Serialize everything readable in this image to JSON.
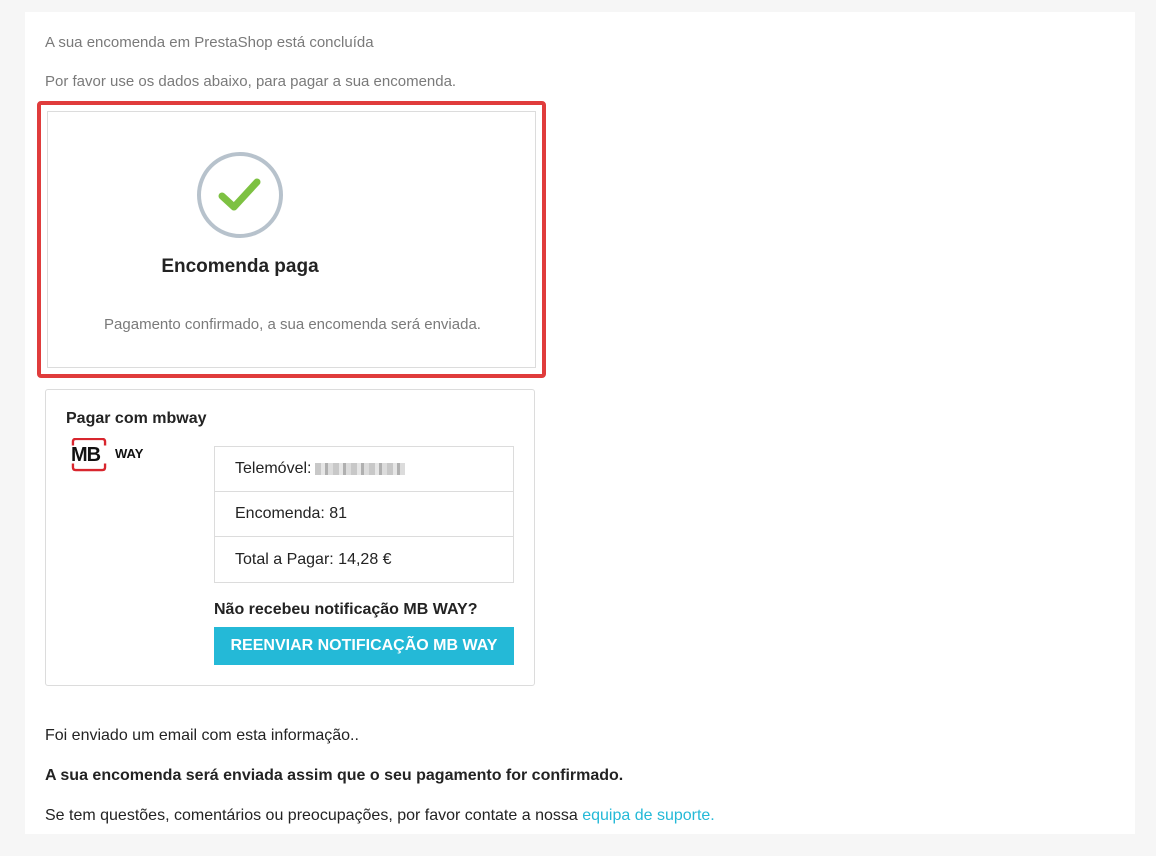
{
  "intro": {
    "line1": "A sua encomenda em PrestaShop está concluída",
    "line2": "Por favor use os dados abaixo, para pagar a sua encomenda."
  },
  "status": {
    "icon": "check-circle-icon",
    "title": "Encomenda paga",
    "message": "Pagamento confirmado, a sua encomenda será enviada.",
    "highlight_color": "#e03c3c",
    "check_color": "#7dc142"
  },
  "mbway": {
    "title": "Pagar com mbway",
    "logo_mb": "MB",
    "logo_way": "WAY",
    "rows": [
      {
        "label": "Telemóvel:"
      },
      {
        "label": "Encomenda: 81"
      },
      {
        "label": "Total a Pagar: 14,28 €"
      }
    ],
    "notification_question": "Não recebeu notificação MB WAY?",
    "resend_button": "REENVIAR NOTIFICAÇÃO MB WAY",
    "button_color": "#24b9d7"
  },
  "footer": {
    "line1": "Foi enviado um email com esta informação..",
    "line2": "A sua encomenda será enviada assim que o seu pagamento for confirmado.",
    "line3_prefix": "Se tem questões, comentários ou preocupações, por favor contate a nossa ",
    "support_link": "equipa de suporte."
  }
}
